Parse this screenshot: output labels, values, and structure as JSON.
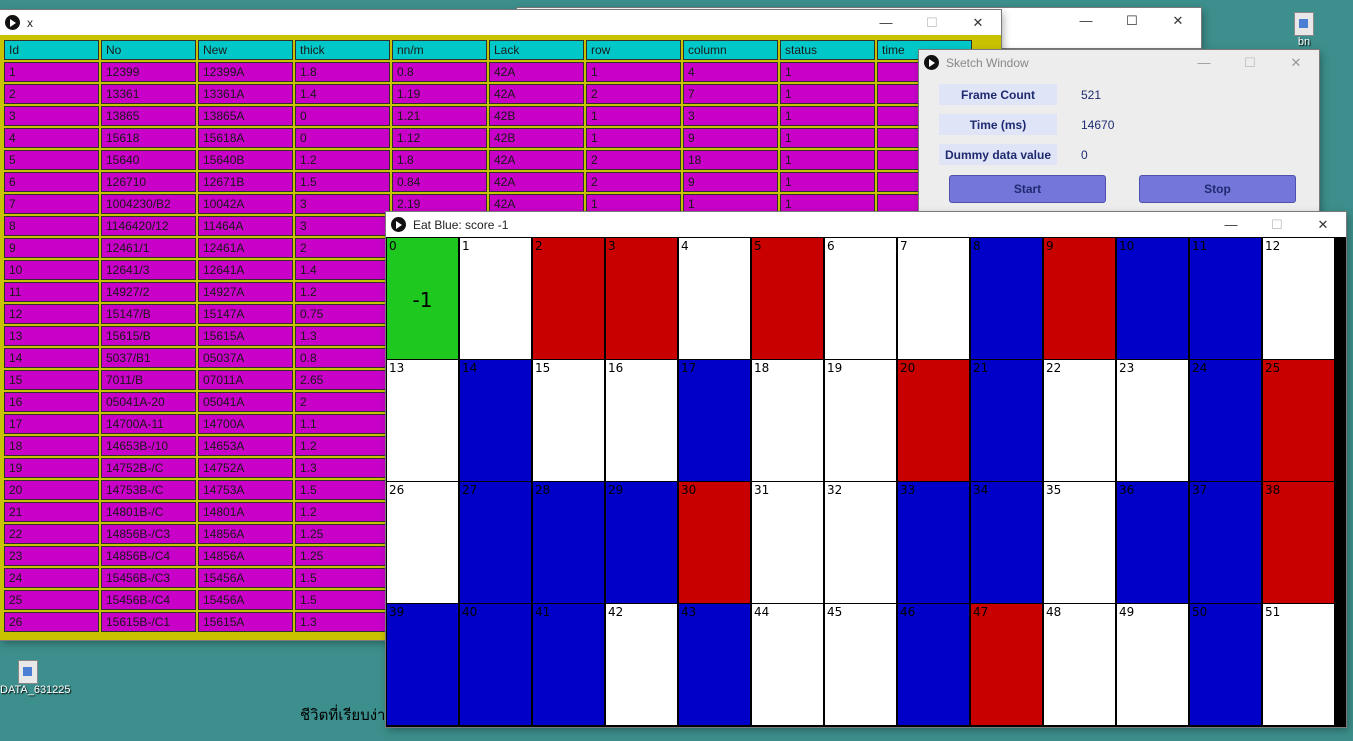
{
  "desktop": {
    "icon_top_right_label": "bn",
    "icon_bottom_left_label": "DATA_631225",
    "wallpaper_text": "ชีวิตที่เรียบง่า"
  },
  "table_window": {
    "title": "x",
    "headers": [
      "Id",
      "No",
      "New",
      "thick",
      "nn/m",
      "Lack",
      "row",
      "column",
      "status",
      "time"
    ],
    "rows": [
      [
        "1",
        "12399",
        "12399A",
        "1.8",
        "0.8",
        "42A",
        "1",
        "4",
        "1",
        ""
      ],
      [
        "2",
        "13361",
        "13361A",
        "1.4",
        "1.19",
        "42A",
        "2",
        "7",
        "1",
        ""
      ],
      [
        "3",
        "13865",
        "13865A",
        "0",
        "1.21",
        "42B",
        "1",
        "3",
        "1",
        ""
      ],
      [
        "4",
        "15618",
        "15618A",
        "0",
        "1.12",
        "42B",
        "1",
        "9",
        "1",
        ""
      ],
      [
        "5",
        "15640",
        "15640B",
        "1.2",
        "1.8",
        "42A",
        "2",
        "18",
        "1",
        ""
      ],
      [
        "6",
        "126710",
        "12671B",
        "1.5",
        "0.84",
        "42A",
        "2",
        "9",
        "1",
        ""
      ],
      [
        "7",
        "1004230/B2",
        "10042A",
        "3",
        "2.19",
        "42A",
        "1",
        "1",
        "1",
        ""
      ],
      [
        "8",
        "1146420/12",
        "11464A",
        "3",
        "",
        "",
        "",
        "",
        "",
        ""
      ],
      [
        "9",
        "12461/1",
        "12461A",
        "2",
        "",
        "",
        "",
        "",
        "",
        ""
      ],
      [
        "10",
        "12641/3",
        "12641A",
        "1.4",
        "",
        "",
        "",
        "",
        "",
        ""
      ],
      [
        "11",
        "14927/2",
        "14927A",
        "1.2",
        "",
        "",
        "",
        "",
        "",
        ""
      ],
      [
        "12",
        "15147/B",
        "15147A",
        "0.75",
        "",
        "",
        "",
        "",
        "",
        ""
      ],
      [
        "13",
        "15615/B",
        "15615A",
        "1.3",
        "",
        "",
        "",
        "",
        "",
        ""
      ],
      [
        "14",
        "5037/B1",
        "05037A",
        "0.8",
        "",
        "",
        "",
        "",
        "",
        ""
      ],
      [
        "15",
        "7011/B",
        "07011A",
        "2.65",
        "",
        "",
        "",
        "",
        "",
        ""
      ],
      [
        "16",
        "05041A-20",
        "05041A",
        "2",
        "",
        "",
        "",
        "",
        "",
        ""
      ],
      [
        "17",
        "14700A-11",
        "14700A",
        "1.1",
        "",
        "",
        "",
        "",
        "",
        ""
      ],
      [
        "18",
        "14653B-/10",
        "14653A",
        "1.2",
        "",
        "",
        "",
        "",
        "",
        ""
      ],
      [
        "19",
        "14752B-/C",
        "14752A",
        "1.3",
        "",
        "",
        "",
        "",
        "",
        ""
      ],
      [
        "20",
        "14753B-/C",
        "14753A",
        "1.5",
        "",
        "",
        "",
        "",
        "",
        ""
      ],
      [
        "21",
        "14801B-/C",
        "14801A",
        "1.2",
        "",
        "",
        "",
        "",
        "",
        ""
      ],
      [
        "22",
        "14856B-/C3",
        "14856A",
        "1.25",
        "",
        "",
        "",
        "",
        "",
        ""
      ],
      [
        "23",
        "14856B-/C4",
        "14856A",
        "1.25",
        "",
        "",
        "",
        "",
        "",
        ""
      ],
      [
        "24",
        "15456B-/C3",
        "15456A",
        "1.5",
        "",
        "",
        "",
        "",
        "",
        ""
      ],
      [
        "25",
        "15456B-/C4",
        "15456A",
        "1.5",
        "",
        "",
        "",
        "",
        "",
        ""
      ],
      [
        "26",
        "15615B-/C1",
        "15615A",
        "1.3",
        "",
        "",
        "",
        "",
        "",
        ""
      ]
    ]
  },
  "sketch_window": {
    "title": "Sketch Window",
    "frame_count_label": "Frame Count",
    "frame_count_value": "521",
    "time_label": "Time (ms)",
    "time_value": "14670",
    "dummy_label": "Dummy data value",
    "dummy_value": "0",
    "start_label": "Start",
    "stop_label": "Stop"
  },
  "game_window": {
    "title": "Eat Blue: score -1",
    "score_display": "-1",
    "colors": {
      "w": "#ffffff",
      "r": "#c80000",
      "b": "#0000c8",
      "g": "#1ec81e"
    },
    "cells": [
      "g",
      "w",
      "r",
      "r",
      "w",
      "r",
      "w",
      "w",
      "b",
      "r",
      "b",
      "b",
      "w",
      "w",
      "b",
      "w",
      "w",
      "b",
      "w",
      "w",
      "r",
      "b",
      "w",
      "w",
      "b",
      "r",
      "w",
      "b",
      "b",
      "b",
      "r",
      "w",
      "w",
      "b",
      "b",
      "w",
      "b",
      "b",
      "r",
      "b",
      "b",
      "b",
      "w",
      "b",
      "w",
      "w",
      "b",
      "r",
      "w",
      "w",
      "b",
      "w"
    ]
  }
}
